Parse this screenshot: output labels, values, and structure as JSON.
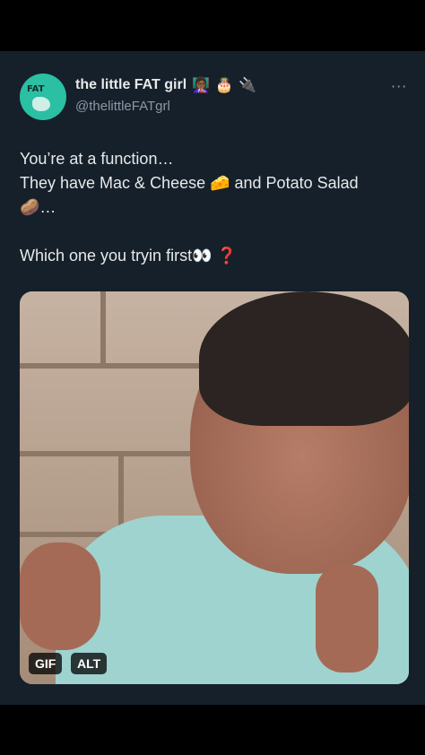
{
  "author": {
    "display_name": "the little FAT girl",
    "name_emojis": [
      "👩🏾‍🏫",
      "🎂",
      "🔌"
    ],
    "handle": "@thelittleFATgrl",
    "avatar_logo_text": "FAT"
  },
  "menu": {
    "more_label": "···"
  },
  "tweet": {
    "lines": [
      "You’re at a function…",
      "They have Mac & Cheese 🧀 and Potato Salad",
      "🥔…",
      "",
      "Which one you tryin first👀 ❓"
    ]
  },
  "media": {
    "gif_badge": "GIF",
    "alt_badge": "ALT"
  },
  "colors": {
    "background": "#15202b",
    "text_primary": "#e7e9ea",
    "text_secondary": "#8b98a5",
    "avatar_bg": "#2bbfa3"
  }
}
